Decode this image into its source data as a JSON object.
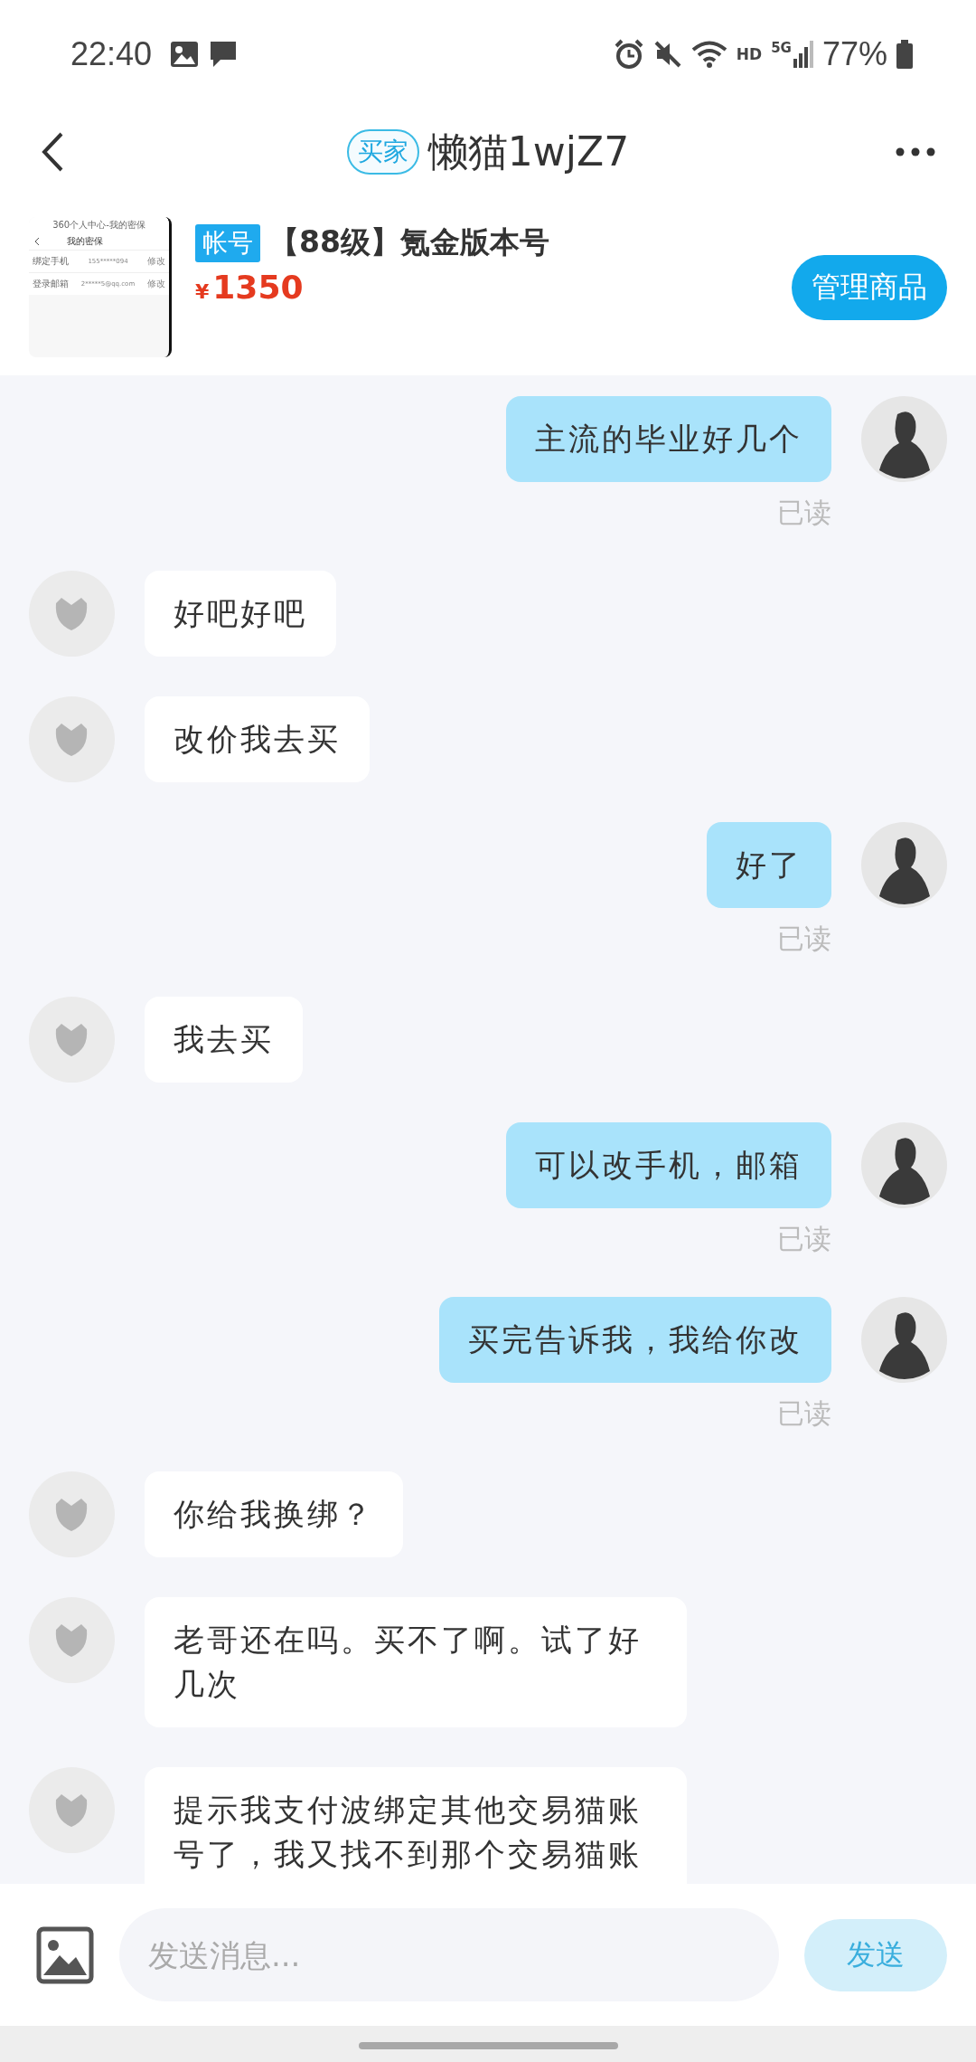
{
  "status_bar": {
    "time": "22:40",
    "network": "HD",
    "network_type": "5G",
    "battery": "77%"
  },
  "header": {
    "badge": "买家",
    "title": "懒猫1wjZ7"
  },
  "product": {
    "thumbnail": {
      "header": "360个人中心-我的密保",
      "title": "我的密保",
      "rows": [
        {
          "label": "绑定手机",
          "value": "155*****094",
          "action": "修改"
        },
        {
          "label": "登录邮箱",
          "value": "2*****5@qq.com",
          "action": "修改"
        }
      ]
    },
    "tag": "帐号",
    "title": "【88级】氪金版本号",
    "currency": "¥",
    "price": "1350",
    "manage_button": "管理商品"
  },
  "messages": [
    {
      "kind": "sent",
      "text": "主流的毕业好几个",
      "status": "已读"
    },
    {
      "kind": "received",
      "text": "好吧好吧"
    },
    {
      "kind": "received",
      "text": "改价我去买"
    },
    {
      "kind": "sent",
      "text": "好了",
      "status": "已读"
    },
    {
      "kind": "received",
      "text": "我去买"
    },
    {
      "kind": "sent",
      "text": "可以改手机，邮箱",
      "status": "已读"
    },
    {
      "kind": "sent",
      "text": "买完告诉我，我给你改",
      "status": "已读"
    },
    {
      "kind": "received",
      "text": "你给我换绑？"
    },
    {
      "kind": "received",
      "text": "老哥还在吗。买不了啊。试了好几次"
    },
    {
      "kind": "received",
      "text": "提示我支付波绑定其他交易猫账号了，我又找不到那个交易猫账"
    }
  ],
  "composer": {
    "placeholder": "发送消息...",
    "send_button": "发送",
    "send_disabled": true
  }
}
